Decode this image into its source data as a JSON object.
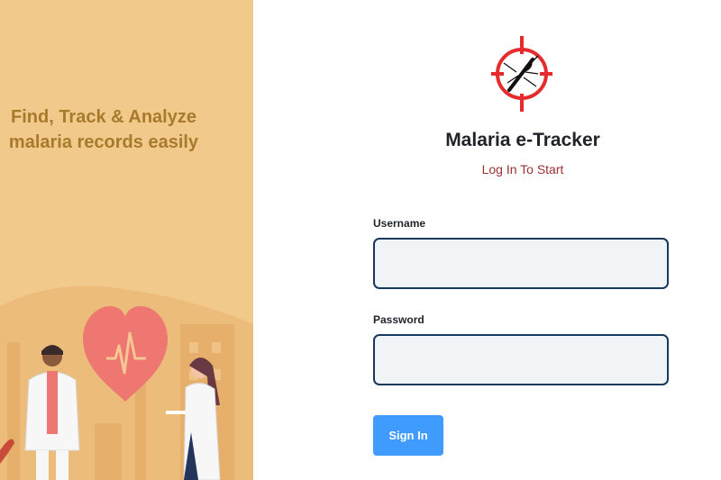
{
  "hero": {
    "tagline_line1": "Find, Track & Analyze",
    "tagline_line2": "malaria records easily",
    "illustration": "doctors-heart-illustration"
  },
  "app": {
    "logo_icon": "mosquito-target-icon",
    "title": "Malaria e-Tracker",
    "subtitle": "Log In To Start"
  },
  "form": {
    "username_label": "Username",
    "username_value": "",
    "password_label": "Password",
    "password_value": "",
    "submit_label": "Sign In"
  },
  "colors": {
    "hero_bg": "#f1c98a",
    "tagline": "#a77a2c",
    "accent": "#3f9bfd",
    "subtitle": "#9b2f2f",
    "input_border": "#173a5c",
    "logo_red": "#e52b2b"
  }
}
